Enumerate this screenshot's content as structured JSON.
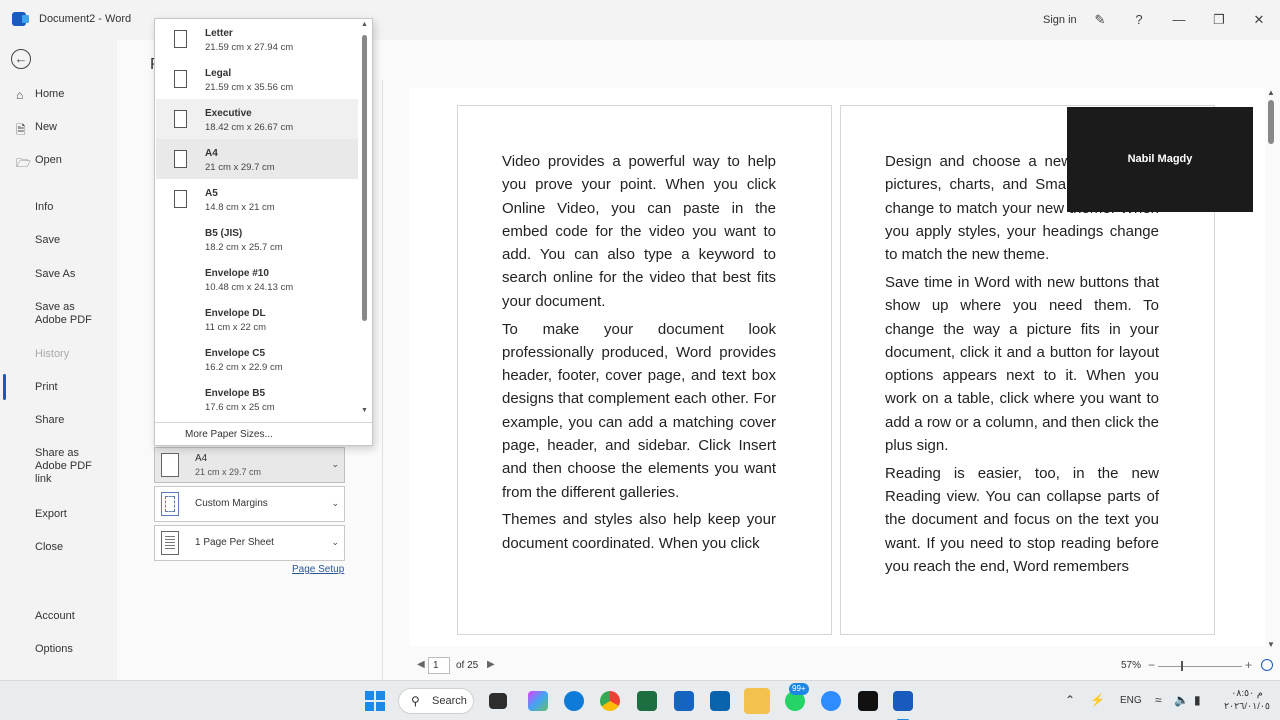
{
  "titlebar": {
    "doc_title": "Document2  -  Word",
    "signin": "Sign in",
    "help": "?"
  },
  "nav": {
    "back_label": "←",
    "items": [
      {
        "label": "Home",
        "icon": "home-icon"
      },
      {
        "label": "New",
        "icon": "new-document-icon"
      },
      {
        "label": "Open",
        "icon": "folder-open-icon"
      },
      {
        "label": "Info"
      },
      {
        "label": "Save"
      },
      {
        "label": "Save As"
      },
      {
        "label": "Save as\nAdobe PDF"
      },
      {
        "label": "History"
      },
      {
        "label": "Print"
      },
      {
        "label": "Share"
      },
      {
        "label": "Share as\nAdobe PDF\nlink"
      },
      {
        "label": "Export"
      },
      {
        "label": "Close"
      },
      {
        "label": "Account"
      },
      {
        "label": "Options"
      }
    ]
  },
  "print": {
    "heading": "P",
    "paper_setting": {
      "name": "A4",
      "dims": "21 cm x 29.7 cm"
    },
    "margins_setting": "Custom Margins",
    "pages_setting": "1 Page Per Sheet",
    "page_setup_link": "Page Setup"
  },
  "paper_dropdown": {
    "items": [
      {
        "name": "Letter",
        "dims": "21.59 cm x 27.94 cm"
      },
      {
        "name": "Legal",
        "dims": "21.59 cm x 35.56 cm"
      },
      {
        "name": "Executive",
        "dims": "18.42 cm x 26.67 cm"
      },
      {
        "name": "A4",
        "dims": "21 cm x 29.7 cm"
      },
      {
        "name": "A5",
        "dims": "14.8 cm x 21 cm"
      },
      {
        "name": "B5 (JIS)",
        "dims": "18.2 cm x 25.7 cm"
      },
      {
        "name": "Envelope #10",
        "dims": "10.48 cm x 24.13 cm"
      },
      {
        "name": "Envelope DL",
        "dims": "11 cm x 22 cm"
      },
      {
        "name": "Envelope C5",
        "dims": "16.2 cm x 22.9 cm"
      },
      {
        "name": "Envelope B5",
        "dims": "17.6 cm x 25 cm"
      }
    ],
    "more": "More Paper Sizes..."
  },
  "preview": {
    "page1": [
      "Video provides a powerful way to help you prove your point. When you click Online Video, you can paste in the embed code for the video you want to add. You can also type a keyword to search online for the video that best fits your document.",
      "To make your document look professionally produced, Word provides header, footer, cover page, and text box designs that complement each other. For example, you can add a matching cover page, header, and sidebar. Click Insert and then choose the elements you want from the different galleries.",
      "Themes and styles also help keep your document coordinated. When you click"
    ],
    "page2": [
      "Design and choose a new Theme, the pictures, charts, and SmartArt graphics change to match your new theme. When you apply styles, your headings change to match the new theme.",
      "Save time in Word with new buttons that show up where you need them. To change the way a picture fits in your document, click it and a button for layout options appears next to it. When you work on a table, click where you want to add a row or a column, and then click the plus sign.",
      "Reading is easier, too, in the new Reading view. You can collapse parts of the document and focus on the text you want. If you need to stop reading before you reach the end, Word remembers"
    ],
    "video_name": "Nabil Magdy",
    "current_page": "1",
    "page_total": "of 25",
    "zoom": "57%"
  },
  "taskbar": {
    "search_label": "Search",
    "badge": "99+",
    "lang": "ENG",
    "time": "م ٠٨:٥٠",
    "date": "٢٠٢٦/٠١/٠٥"
  }
}
